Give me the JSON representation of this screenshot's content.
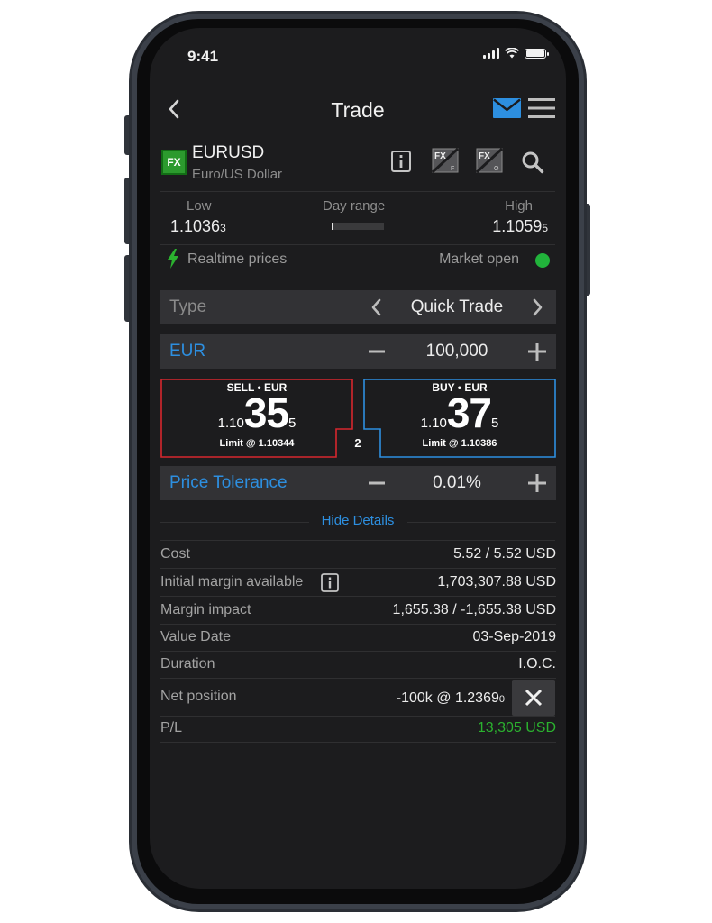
{
  "status_bar": {
    "time": "9:41"
  },
  "nav": {
    "title": "Trade"
  },
  "instrument": {
    "badge": "FX",
    "symbol": "EURUSD",
    "description": "Euro/US Dollar"
  },
  "day_range": {
    "low_label": "Low",
    "low_value": "1.1036",
    "low_pip": "3",
    "range_label": "Day range",
    "high_label": "High",
    "high_value": "1.1059",
    "high_pip": "5"
  },
  "feed": {
    "realtime_label": "Realtime prices",
    "market_status": "Market open",
    "status_color": "#21b33b"
  },
  "order": {
    "type_label": "Type",
    "type_value": "Quick Trade",
    "currency_label": "EUR",
    "amount": "100,000",
    "tolerance_label": "Price Tolerance",
    "tolerance_value": "0.01%"
  },
  "sell": {
    "header": "SELL • EUR",
    "prefix": "1.10",
    "big": "35",
    "pip": "5",
    "limit": "Limit @ 1.10344",
    "color": "#d6262e"
  },
  "buy": {
    "header": "BUY • EUR",
    "prefix": "1.10",
    "big": "37",
    "pip": "5",
    "limit": "Limit @ 1.10386",
    "color": "#2d8fe0"
  },
  "spread": "2",
  "details": {
    "toggle_label": "Hide Details",
    "rows": [
      {
        "label": "Cost",
        "value": "5.52 / 5.52 USD"
      },
      {
        "label": "Initial margin available",
        "value": "1,703,307.88 USD"
      },
      {
        "label": "Margin impact",
        "value": "1,655.38 / -1,655.38 USD"
      },
      {
        "label": "Value Date",
        "value": "03-Sep-2019"
      },
      {
        "label": "Duration",
        "value": "I.O.C."
      },
      {
        "label": "Net position",
        "value": "-100k @ 1.2369",
        "value_pip": "0"
      },
      {
        "label": "P/L",
        "value": "13,305 USD",
        "value_color": "#2bb12f"
      }
    ]
  }
}
